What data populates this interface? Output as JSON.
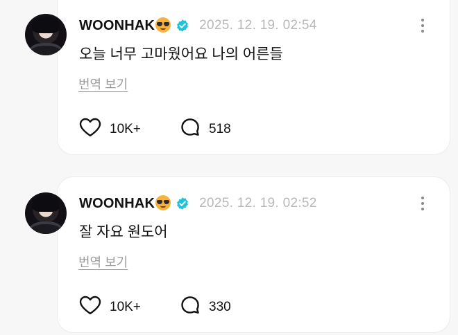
{
  "posts": [
    {
      "username": "WOONHAK",
      "emoji": "smiling-face-with-sunglasses",
      "verified": true,
      "timestamp": "2025. 12. 19. 02:54",
      "text": "오늘 너무 고마웠어요 나의 어른들",
      "translate_label": "번역 보기",
      "likes": "10K+",
      "comments": "518"
    },
    {
      "username": "WOONHAK",
      "emoji": "smiling-face-with-sunglasses",
      "verified": true,
      "timestamp": "2025. 12. 19. 02:52",
      "text": "잘 자요 원도어",
      "translate_label": "번역 보기",
      "likes": "10K+",
      "comments": "330"
    }
  ],
  "colors": {
    "verified": "#1ec3d8",
    "timestamp": "#b8b8b8",
    "link": "#9a9a9a",
    "text": "#111111"
  }
}
